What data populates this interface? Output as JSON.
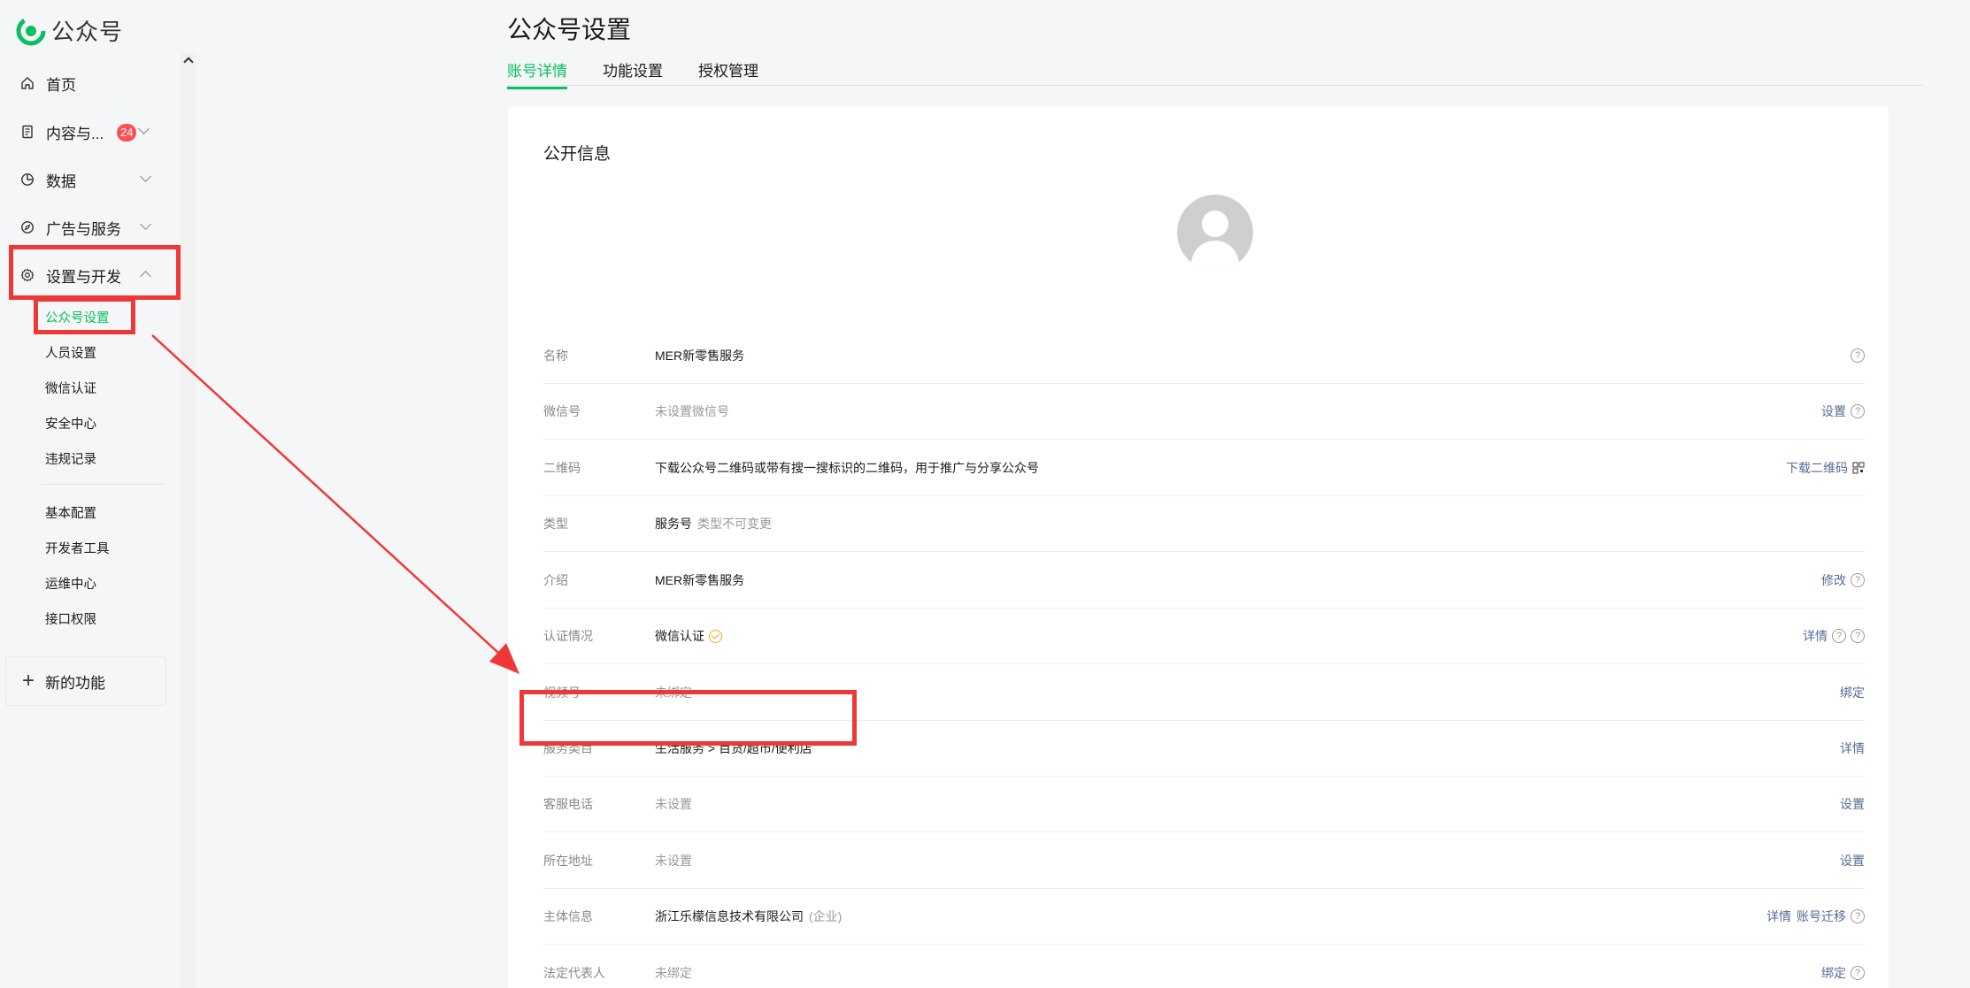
{
  "app": {
    "logo_text": "公众号"
  },
  "sidebar": {
    "items": [
      {
        "label": "首页",
        "icon": "home-icon"
      },
      {
        "label": "内容与...",
        "icon": "document-icon",
        "badge": "24"
      },
      {
        "label": "数据",
        "icon": "chart-pie-icon"
      },
      {
        "label": "广告与服务",
        "icon": "compass-icon"
      },
      {
        "label": "设置与开发",
        "icon": "gear-icon"
      }
    ],
    "sub_items": [
      {
        "label": "公众号设置",
        "active": true
      },
      {
        "label": "人员设置"
      },
      {
        "label": "微信认证"
      },
      {
        "label": "安全中心"
      },
      {
        "label": "违规记录"
      },
      {
        "label": "基本配置"
      },
      {
        "label": "开发者工具"
      },
      {
        "label": "运维中心"
      },
      {
        "label": "接口权限"
      }
    ],
    "new_feature": "新的功能"
  },
  "page": {
    "title": "公众号设置",
    "tabs": [
      "账号详情",
      "功能设置",
      "授权管理"
    ],
    "active_tab": "账号详情"
  },
  "card": {
    "title": "公开信息",
    "rows": [
      {
        "label": "名称",
        "value": "MER新零售服务"
      },
      {
        "label": "微信号",
        "value": "未设置微信号",
        "action": "设置"
      },
      {
        "label": "二维码",
        "value": "下载公众号二维码或带有搜一搜标识的二维码，用于推广与分享公众号",
        "action": "下载二维码"
      },
      {
        "label": "类型",
        "value": "服务号",
        "note": "类型不可变更"
      },
      {
        "label": "介绍",
        "value": "MER新零售服务",
        "action": "修改"
      },
      {
        "label": "认证情况",
        "value": "微信认证",
        "action": "详情"
      },
      {
        "label": "视频号",
        "value": "未绑定",
        "action": "绑定"
      },
      {
        "label": "服务类目",
        "value": "生活服务 > 百货/超市/便利店",
        "action": "详情"
      },
      {
        "label": "客服电话",
        "value": "未设置",
        "action": "设置"
      },
      {
        "label": "所在地址",
        "value": "未设置",
        "action": "设置"
      },
      {
        "label": "主体信息",
        "value": "浙江乐檬信息技术有限公司",
        "note": "(企业)",
        "action": "详情",
        "action2": "账号迁移"
      },
      {
        "label": "法定代表人",
        "value": "未绑定",
        "action": "绑定"
      }
    ]
  },
  "colors": {
    "accent": "#07c160",
    "highlight": "#ee3838",
    "link": "#576b95",
    "badge": "#fa5151"
  }
}
